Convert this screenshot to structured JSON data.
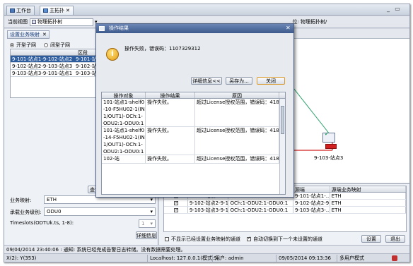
{
  "tabs": [
    {
      "label": "工作台"
    },
    {
      "label": "主拓扑"
    }
  ],
  "toolbar": {
    "view_label": "当前视图",
    "view_value": "物理拓扑树",
    "location_prefix": "位:",
    "location_value": "物理拓扑树/"
  },
  "left_panel": {
    "tab_label": "设置业务映射",
    "radio_open": "开型子网",
    "radio_closed": "闭型子网",
    "column_header": "区段",
    "rows": [
      {
        "a": "9-101-站点1-9-102-站点2",
        "b": "9-101-站点1"
      },
      {
        "a": "9-102-站点2-9-103-站点3",
        "b": "9-102-站点2"
      },
      {
        "a": "9-103-站点3-9-101-站点1",
        "b": "9-103-站点3"
      }
    ],
    "query_button": "查询区段服务路径",
    "clear_button": "清空",
    "service_mapping_label": "业务映射:",
    "service_mapping_value": "ETH",
    "carrier_level_label": "承载业务级别:",
    "carrier_level_value": "ODU0",
    "timeslots_label": "Timeslots(ODTUk.ts, 1-8):",
    "timeslots_value": "1",
    "detail_button": "详细信息"
  },
  "canvas": {
    "node_label": "9-103-站点3"
  },
  "bottom_table": {
    "headers": [
      "标志",
      "区段",
      "通道",
      "源端",
      "源端业务映射"
    ],
    "rows": [
      {
        "seg": "9-101-站点1-9-10...",
        "ch": "OCh:1-ODU2:1-ODU0:1",
        "src": "9-101-站点1-...",
        "map": "ETH"
      },
      {
        "seg": "9-102-站点2-9-10...",
        "ch": "OCh:1-ODU2:1-ODU0:1",
        "src": "9-102-站点2-9...",
        "map": "ETH"
      },
      {
        "seg": "9-103-站点3-9-10...",
        "ch": "OCh:1-ODU2:1-ODU0:1",
        "src": "9-103-站点3-...",
        "map": "ETH"
      }
    ],
    "hide_configured_label": "不显示已经设置业务映射的通道",
    "auto_switch_label": "自动切换到下一个未设置的通道",
    "settings_button": "设置",
    "exit_button": "退出"
  },
  "status_message": "09/04/2014 23:40:06 : 通知: 系统已经完成告警日志转储。没有数据需要处理。",
  "statusbar": {
    "coords": "X(2):  Y(353)",
    "localhost": "Localhost: 127.0.0.1(模式:S...",
    "user": "用户: admin",
    "datetime": "09/05/2014 09:13:36",
    "mode": "多用户模式"
  },
  "dialog": {
    "title": "操作结果",
    "message": "操作失败，错误码：1107329312",
    "detail_button": "详细信息<<",
    "save_as_button": "另存为...",
    "close_button": "关闭",
    "headers": [
      "操作对象",
      "操作结果",
      "原因"
    ],
    "rows": [
      {
        "obj": "101-站点1-shelf0-10-F5HU02-1(IN1/OUT1)-OCh:1-ODU2:1-ODU0:1",
        "result": "操作失败。",
        "reason": "超过License授权范围，错误码：41861"
      },
      {
        "obj": "101-站点1-shelf0-14-F5HU02-1(IN1/OUT1)-OCh:1-ODU2:1-ODU0:1",
        "result": "操作失败。",
        "reason": "超过License授权范围，错误码：41861"
      },
      {
        "obj": "102-站",
        "result": "操作失败。",
        "reason": "超过License授权范围，错误码：41861"
      }
    ]
  },
  "colors": {
    "title_bar": "#3d5a8c",
    "selection": "#2e5d9e",
    "link": "#d22020",
    "link_green": "#2aa06a"
  }
}
